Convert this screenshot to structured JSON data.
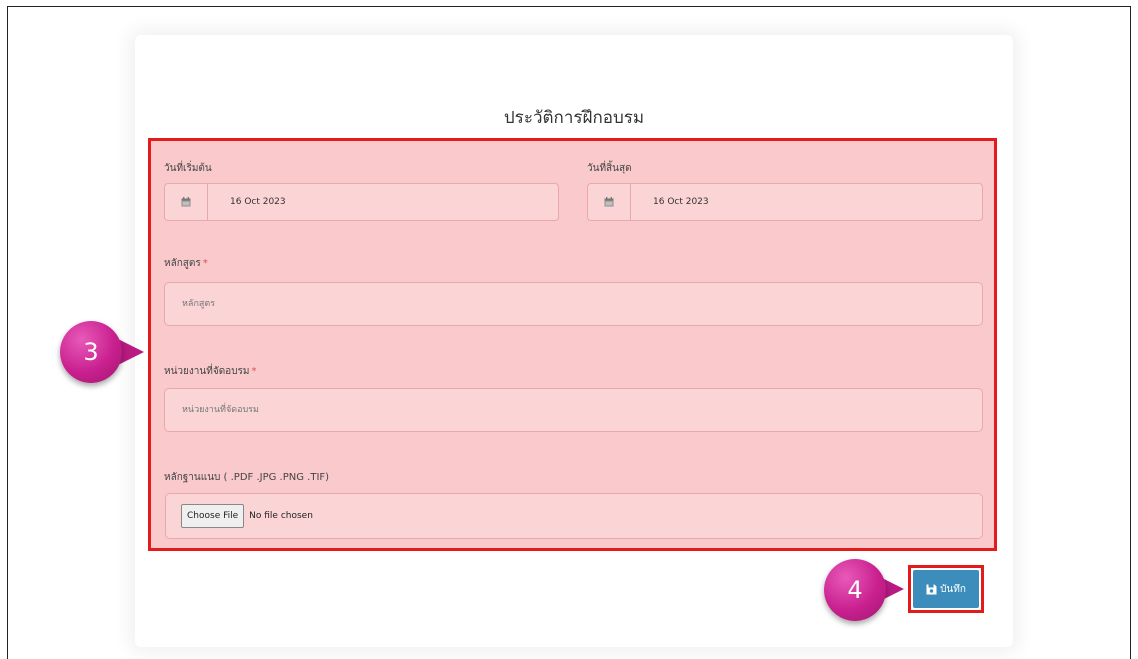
{
  "form": {
    "title": "ประวัติการฝึกอบรม",
    "start_date": {
      "label": "วันที่เริ่มต้น",
      "value": "16 Oct 2023",
      "icon": "calendar-icon"
    },
    "end_date": {
      "label": "วันที่สิ้นสุด",
      "value": "16 Oct 2023",
      "icon": "calendar-icon"
    },
    "course": {
      "label": "หลักสูตร",
      "required_mark": "*",
      "placeholder": "หลักสูตร"
    },
    "organizer": {
      "label": "หน่วยงานที่จัดอบรม",
      "required_mark": "*",
      "placeholder": "หน่วยงานที่จัดอบรม"
    },
    "evidence": {
      "label": "หลักฐานแนบ ( .PDF .JPG .PNG .TIF)",
      "choose_label": "Choose File",
      "status": "No file chosen"
    },
    "save": {
      "label": "บันทึก",
      "icon": "save-icon"
    }
  },
  "annotations": {
    "step_form": "3",
    "step_save": "4",
    "highlight_color": "#e41b1b",
    "badge_color": "#c9208f"
  }
}
